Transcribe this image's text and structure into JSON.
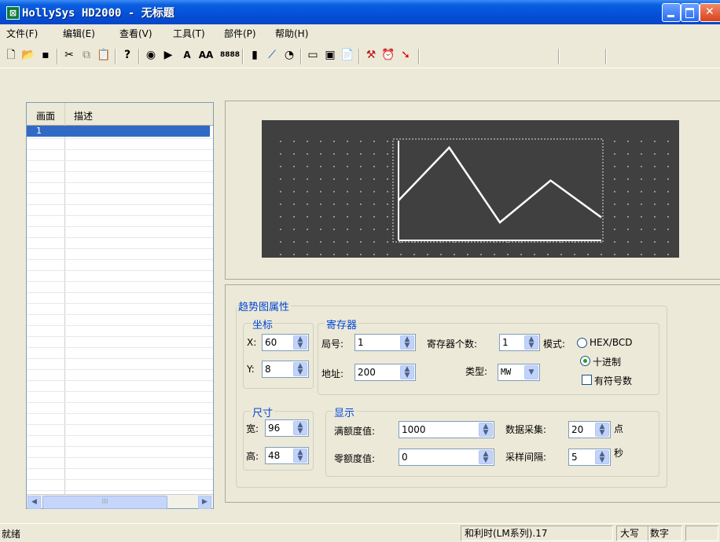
{
  "window": {
    "title": "HollySys HD2000 - 无标题"
  },
  "menu": [
    "文件(F)",
    "编辑(E)",
    "查看(V)",
    "工具(T)",
    "部件(P)",
    "帮助(H)"
  ],
  "toolbar": {
    "icons": [
      "new-file-icon",
      "open-folder-icon",
      "save-icon",
      "cut-icon",
      "copy-icon",
      "paste-icon",
      "help-icon",
      "target-icon",
      "play-icon",
      "text-a-icon",
      "text-aa-icon",
      "numeric-display-icon",
      "bar-graph-icon",
      "trend-chart-icon",
      "pie-chart-icon",
      "rectangle-icon",
      "window-icon",
      "clipboard-icon",
      "tools-icon",
      "alarm-clock-icon",
      "arrow-icon"
    ],
    "text_a": "A",
    "text_aa": "AA",
    "num_display": "8888"
  },
  "screen_list": {
    "col_screen": "画面",
    "col_desc": "描述",
    "rows": [
      {
        "num": "1",
        "desc": ""
      }
    ],
    "scroll_thumb": "III"
  },
  "trend_preview": {
    "chart_data": {
      "type": "line",
      "series": [
        {
          "values": [
            40,
            93,
            18,
            60,
            23
          ]
        }
      ],
      "ylim": [
        0,
        100
      ],
      "grid": true
    }
  },
  "props": {
    "title": "趋势图属性",
    "coords": {
      "label": "坐标",
      "x_label": "X:",
      "x_value": "60",
      "y_label": "Y:",
      "y_value": "8"
    },
    "size": {
      "label": "尺寸",
      "width_label": "宽:",
      "width_value": "96",
      "height_label": "高:",
      "height_value": "48"
    },
    "register": {
      "label": "寄存器",
      "station_label": "局号:",
      "station_value": "1",
      "count_label": "寄存器个数:",
      "count_value": "1",
      "mode_label": "模式:",
      "mode_hex": "HEX/BCD",
      "mode_dec": "十进制",
      "mode_selected": "十进制",
      "signed_label": "有符号数",
      "signed_checked": false,
      "address_label": "地址:",
      "address_value": "200",
      "type_label": "类型:",
      "type_value": "MW"
    },
    "display": {
      "label": "显示",
      "full_label": "满额度值:",
      "full_value": "1000",
      "zero_label": "零额度值:",
      "zero_value": "0",
      "collect_label": "数据采集:",
      "collect_value": "20",
      "collect_unit": "点",
      "interval_label": "采样间隔:",
      "interval_value": "5",
      "interval_unit": "秒"
    }
  },
  "status": {
    "ready": "就绪",
    "device": "和利时(LM系列).17",
    "caps": "大写",
    "num": "数字"
  },
  "colors": {
    "title_bar": "#0550d8",
    "canvas_bg": "#404040",
    "selection": "#316ac5",
    "group_label": "#0046d5"
  }
}
